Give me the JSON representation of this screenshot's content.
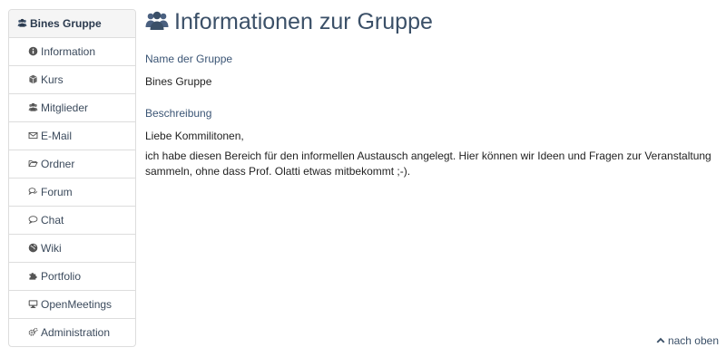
{
  "sidebar": {
    "header": {
      "label": "Bines Gruppe",
      "icon": "users-icon"
    },
    "items": [
      {
        "label": "Information",
        "icon": "info-circle-icon"
      },
      {
        "label": "Kurs",
        "icon": "cube-icon"
      },
      {
        "label": "Mitglieder",
        "icon": "users-icon"
      },
      {
        "label": "E-Mail",
        "icon": "envelope-icon"
      },
      {
        "label": "Ordner",
        "icon": "folder-open-icon"
      },
      {
        "label": "Forum",
        "icon": "comments-icon"
      },
      {
        "label": "Chat",
        "icon": "comment-icon"
      },
      {
        "label": "Wiki",
        "icon": "globe-icon"
      },
      {
        "label": "Portfolio",
        "icon": "puzzle-icon"
      },
      {
        "label": "OpenMeetings",
        "icon": "desktop-icon"
      },
      {
        "label": "Administration",
        "icon": "cogs-icon"
      }
    ]
  },
  "main": {
    "title": "Informationen zur Gruppe",
    "name_label": "Name der Gruppe",
    "name_value": "Bines Gruppe",
    "description_label": "Beschreibung",
    "description_greeting": "Liebe Kommilitonen,",
    "description_body": "ich habe diesen Bereich für den informellen Austausch angelegt. Hier können wir Ideen und Fragen zur Veranstaltung sammeln, ohne dass Prof. Olatti etwas mitbekommt ;-)."
  },
  "footer": {
    "back_to_top": "nach oben",
    "icon": "chevron-up-icon"
  },
  "colors": {
    "accent": "#3b5068",
    "border": "#dddddd",
    "header_bg": "#f5f5f5"
  }
}
